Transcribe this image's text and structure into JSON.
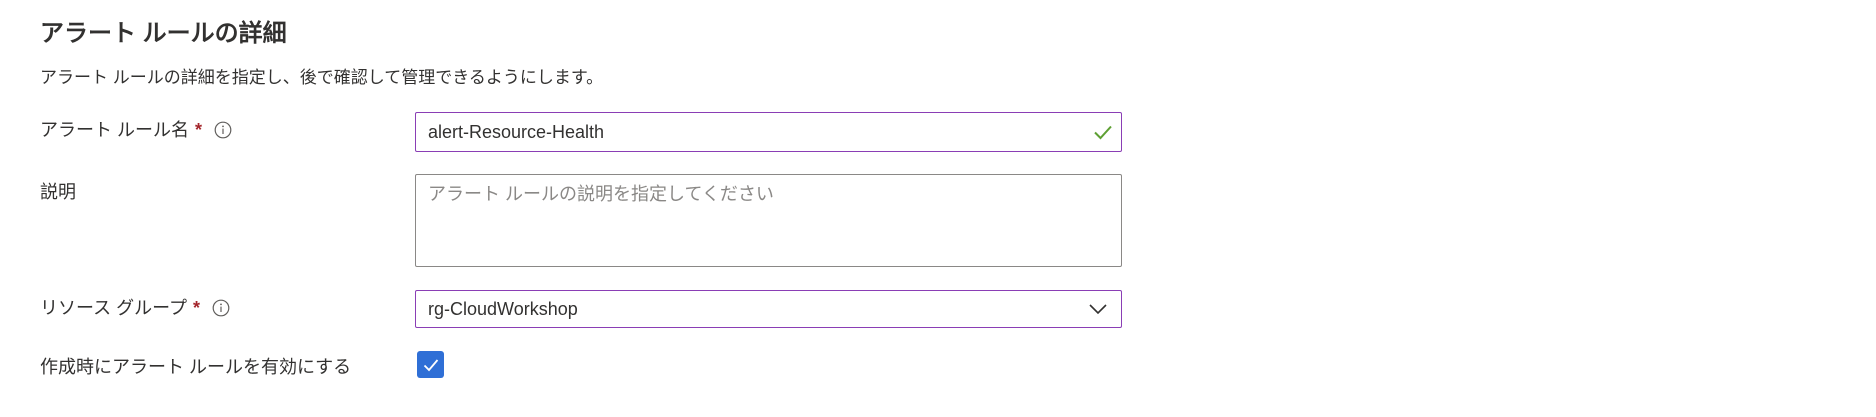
{
  "section": {
    "title": "アラート ルールの詳細",
    "description": "アラート ルールの詳細を指定し、後で確認して管理できるようにします。"
  },
  "fields": {
    "rule_name": {
      "label": "アラート ルール名",
      "required_mark": "*",
      "value": "alert-Resource-Health",
      "valid": true
    },
    "description": {
      "label": "説明",
      "placeholder": "アラート ルールの説明を指定してください",
      "value": ""
    },
    "resource_group": {
      "label": "リソース グループ",
      "required_mark": "*",
      "selected": "rg-CloudWorkshop"
    },
    "enable_on_create": {
      "label": "作成時にアラート ルールを有効にする",
      "checked": true
    }
  },
  "colors": {
    "focus_border": "#8a3eb5",
    "required": "#a4262c",
    "valid_check": "#5ea033",
    "checkbox_fill": "#2f6fd6"
  },
  "icons": {
    "info": "info-icon",
    "valid": "checkmark-icon",
    "dropdown": "chevron-down-icon",
    "checkbox": "checkbox-checked-icon"
  }
}
